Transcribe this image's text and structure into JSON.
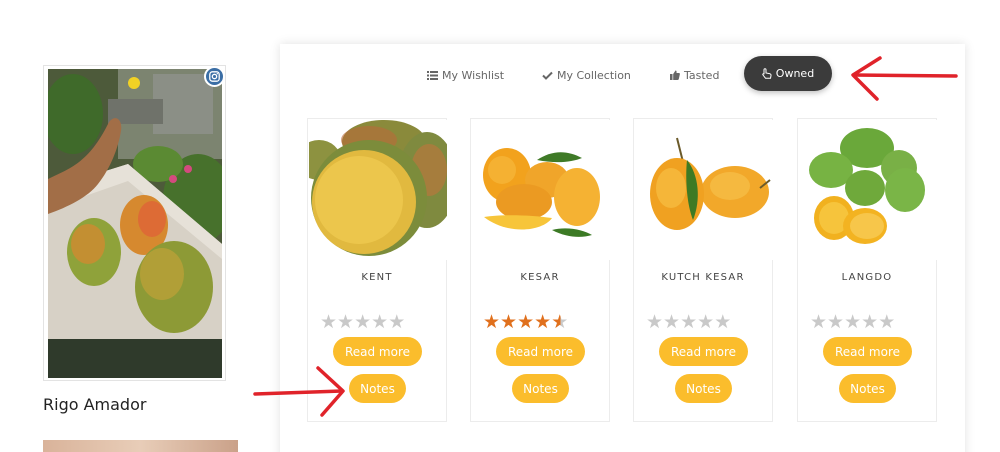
{
  "profile": {
    "name": "Rigo Amador",
    "photo_badge_icon": "instagram-icon"
  },
  "tabs": [
    {
      "label": "My Wishlist",
      "icon": "list-icon"
    },
    {
      "label": "My Collection",
      "icon": "check-icon"
    },
    {
      "label": "Tasted",
      "icon": "thumbs-up-icon"
    },
    {
      "label": "Owned",
      "icon": "hand-pointer-icon",
      "active": true
    }
  ],
  "cards": [
    {
      "name": "KENT",
      "rating": 0,
      "max_rating": 5,
      "read_more_label": "Read more",
      "notes_label": "Notes"
    },
    {
      "name": "KESAR",
      "rating": 4.5,
      "max_rating": 5,
      "read_more_label": "Read more",
      "notes_label": "Notes"
    },
    {
      "name": "KUTCH KESAR",
      "rating": 0,
      "max_rating": 5,
      "read_more_label": "Read more",
      "notes_label": "Notes"
    },
    {
      "name": "LANGDO",
      "rating": 0,
      "max_rating": 5,
      "read_more_label": "Read more",
      "notes_label": "Notes"
    }
  ],
  "colors": {
    "accent_button": "#fbbd2c",
    "active_tab": "#3b3b3b",
    "star_on": "#e0701d",
    "star_off": "#c9c9c9",
    "annotation_arrow": "#e0232a"
  }
}
